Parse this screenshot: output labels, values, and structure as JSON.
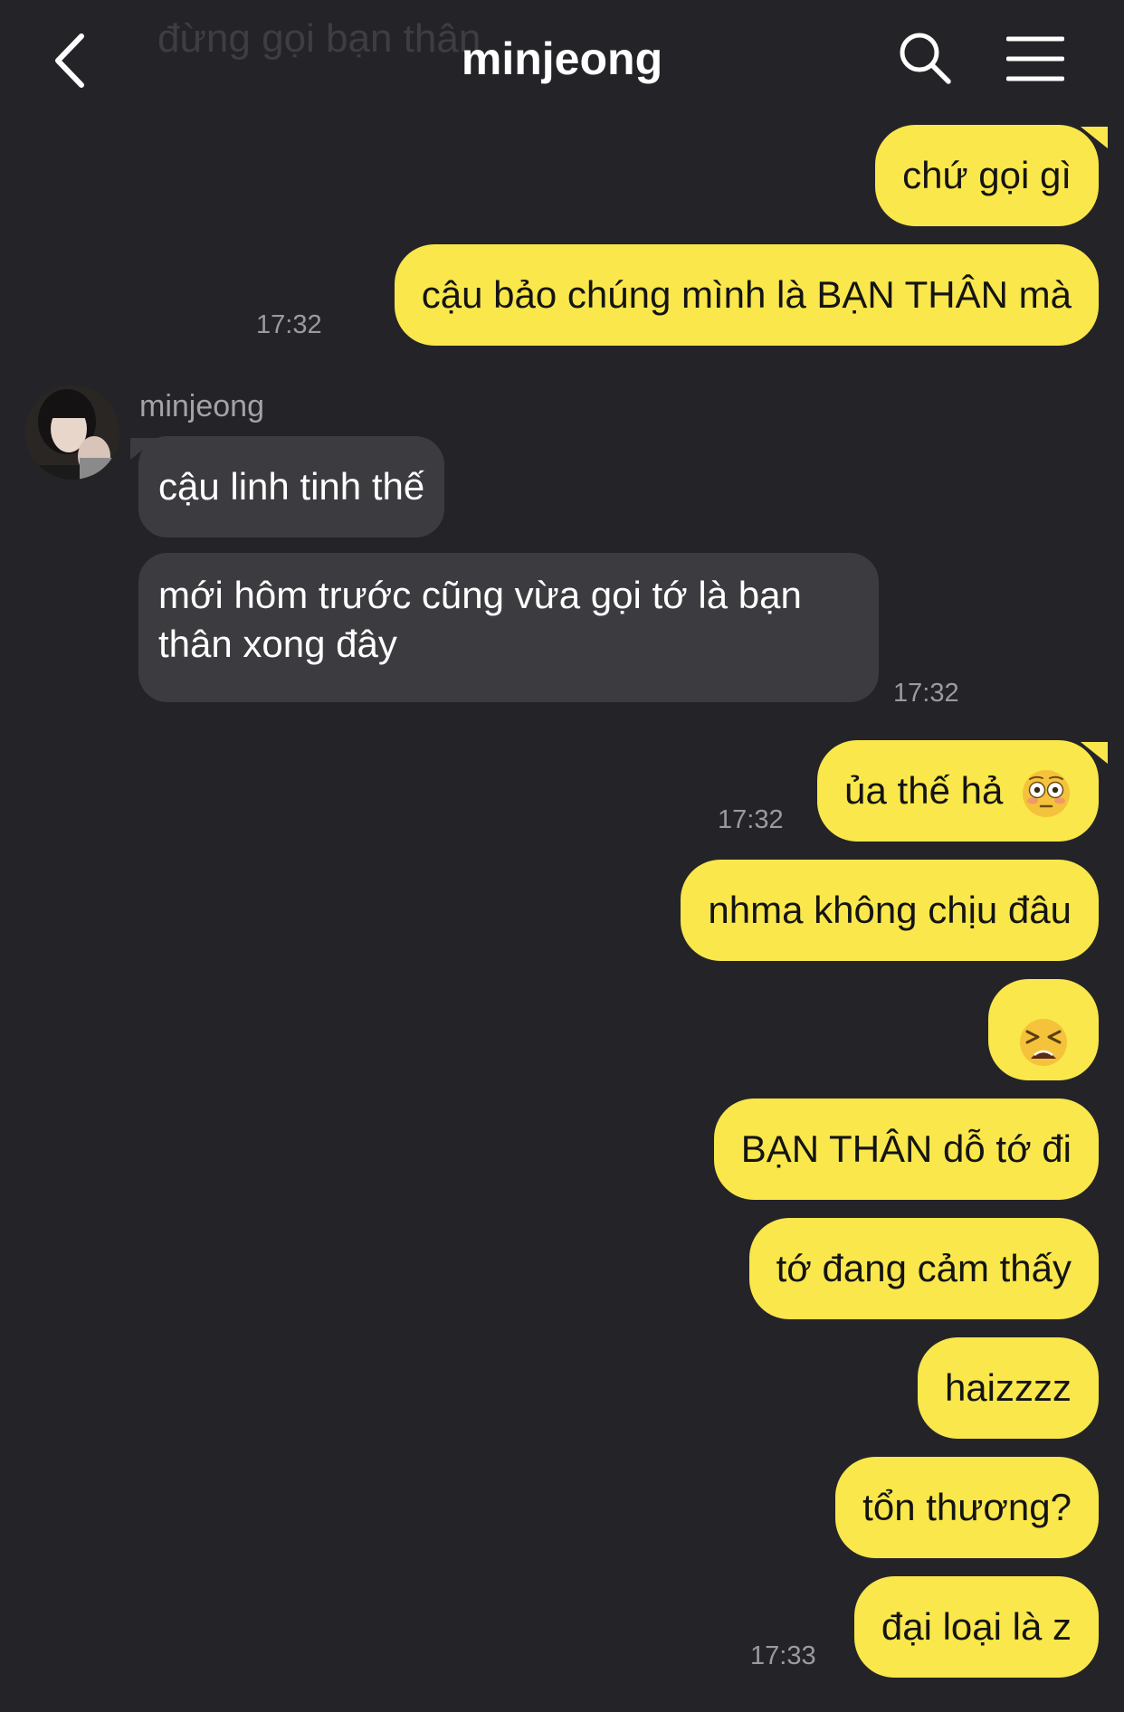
{
  "header": {
    "title": "minjeong",
    "ghost_text": "đừng gọi bạn thân"
  },
  "icons": {
    "back": "back-arrow-icon",
    "search": "search-icon",
    "menu": "menu-icon",
    "flushed": "flushed-face-emoji",
    "tired": "tired-face-emoji"
  },
  "colors": {
    "background": "#242428",
    "my_bubble": "#fae74b",
    "other_bubble": "#3c3c40",
    "timestamp": "#9b9b9f"
  },
  "chat": {
    "sender_name": "minjeong",
    "messages": [
      {
        "from": "me",
        "text": "chứ gọi gì"
      },
      {
        "from": "me",
        "text": "cậu bảo chúng mình là BẠN THÂN mà",
        "time": "17:32"
      },
      {
        "from": "other",
        "text": "cậu linh tinh thế"
      },
      {
        "from": "other",
        "line1": "mới hôm trước cũng vừa gọi tớ là bạn",
        "line2": "thân xong đây",
        "time": "17:32"
      },
      {
        "from": "me",
        "text": "ủa thế hả",
        "time": "17:32"
      },
      {
        "from": "me",
        "text": "nhma không chịu đâu"
      },
      {
        "from": "me",
        "text": ""
      },
      {
        "from": "me",
        "text": "BẠN THÂN dỗ tớ đi"
      },
      {
        "from": "me",
        "text": "tớ đang cảm thấy"
      },
      {
        "from": "me",
        "text": "haizzzz"
      },
      {
        "from": "me",
        "text": "tổn thương?"
      },
      {
        "from": "me",
        "text": "đại loại là z",
        "time": "17:33"
      }
    ]
  }
}
